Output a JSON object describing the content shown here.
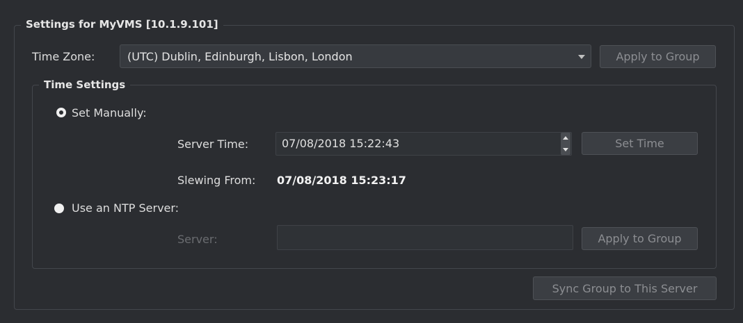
{
  "settings_group": {
    "title": "Settings for MyVMS [10.1.9.101]",
    "time_zone_label": "Time Zone:",
    "time_zone_value": "(UTC) Dublin, Edinburgh, Lisbon, London",
    "apply_to_group_label": "Apply to Group",
    "sync_group_label": "Sync Group to This Server"
  },
  "time_settings": {
    "title": "Time Settings",
    "set_manually_label": "Set Manually:",
    "server_time_label": "Server Time:",
    "server_time_value": "07/08/2018 15:22:43",
    "set_time_label": "Set Time",
    "slewing_from_label": "Slewing From:",
    "slewing_from_value": "07/08/2018 15:23:17",
    "use_ntp_label": "Use an NTP Server:",
    "server_label": "Server:",
    "server_value": "",
    "ntp_apply_label": "Apply to Group"
  },
  "state": {
    "selected_mode": "manual"
  }
}
